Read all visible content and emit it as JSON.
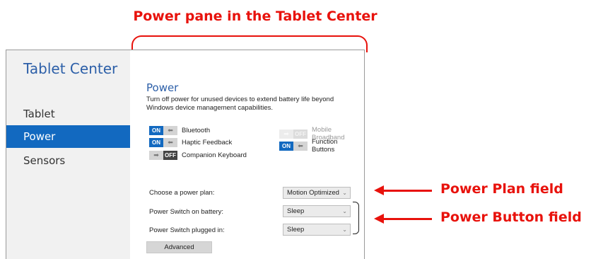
{
  "annotations": {
    "top": "Power pane in the Tablet Center",
    "power_plan": "Power Plan field",
    "power_button": "Power Button field"
  },
  "app": {
    "title": "Tablet Center",
    "nav": [
      {
        "label": "Tablet",
        "active": false
      },
      {
        "label": "Power",
        "active": true
      },
      {
        "label": "Sensors",
        "active": false
      }
    ]
  },
  "pane": {
    "title": "Power",
    "description": "Turn off power for unused devices to extend battery life beyond Windows device management capabilities.",
    "toggles": {
      "bluetooth": {
        "label": "Bluetooth",
        "state": "ON"
      },
      "haptic": {
        "label": "Haptic Feedback",
        "state": "ON"
      },
      "companion_keyboard": {
        "label": "Companion Keyboard",
        "state": "OFF"
      },
      "mobile_broadband": {
        "label": "Mobile Broadband",
        "state": "OFF"
      },
      "function_buttons": {
        "label": "Function Buttons",
        "state": "ON"
      }
    },
    "fields": {
      "power_plan": {
        "label": "Choose a power plan:",
        "value": "Motion Optimized"
      },
      "switch_battery": {
        "label": "Power Switch on battery:",
        "value": "Sleep"
      },
      "switch_plugged": {
        "label": "Power Switch plugged in:",
        "value": "Sleep"
      }
    },
    "advanced_label": "Advanced"
  },
  "colors": {
    "accent": "#1269c0",
    "annotation": "#e8120c",
    "title_blue": "#2c5fa8"
  }
}
